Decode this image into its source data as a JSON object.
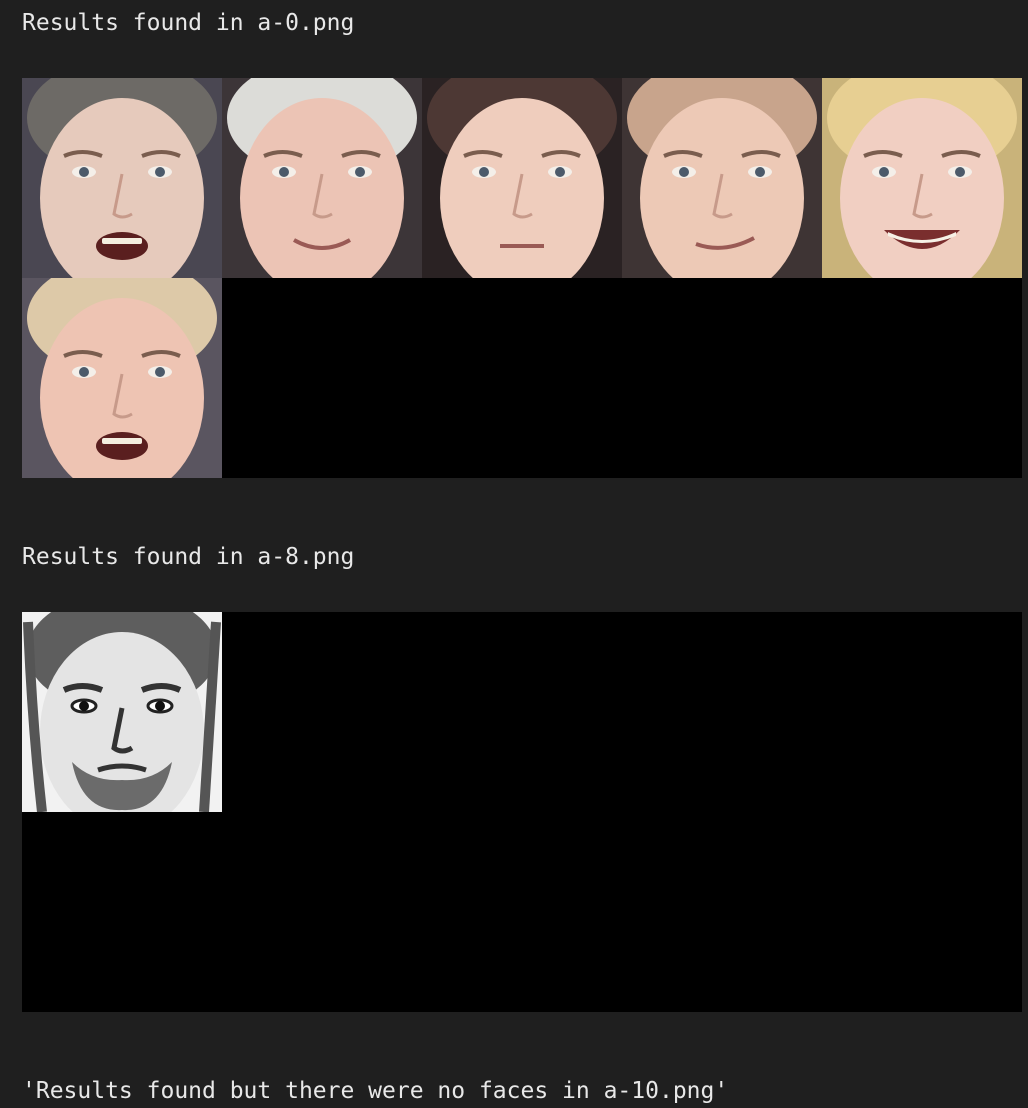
{
  "outputs": [
    {
      "kind": "grid",
      "heading": "Results found in a-0.png",
      "faces": [
        {
          "label": "face-1",
          "icon": "face-thumbnail-icon",
          "skin": "#e6cabc",
          "hair": "#6d6a66",
          "bg": "#4a4752",
          "mouth": "open"
        },
        {
          "label": "face-2",
          "icon": "face-thumbnail-icon",
          "skin": "#ecc4b5",
          "hair": "#dcdcd8",
          "bg": "#3c3538",
          "mouth": "smile"
        },
        {
          "label": "face-3",
          "icon": "face-thumbnail-icon",
          "skin": "#efcdbd",
          "hair": "#4d3834",
          "bg": "#2a2223",
          "mouth": "neutral"
        },
        {
          "label": "face-4",
          "icon": "face-thumbnail-icon",
          "skin": "#edc9b6",
          "hair": "#c8a48c",
          "bg": "#3e3434",
          "mouth": "smirk"
        },
        {
          "label": "face-5",
          "icon": "face-thumbnail-icon",
          "skin": "#f1cfc2",
          "hair": "#e7cf92",
          "bg": "#c9b37a",
          "mouth": "grin"
        },
        {
          "label": "face-6",
          "icon": "face-thumbnail-icon",
          "skin": "#eec4b3",
          "hair": "#ddc9a8",
          "bg": "#5a5560",
          "mouth": "open"
        }
      ]
    },
    {
      "kind": "grid",
      "heading": "Results found in a-8.png",
      "faces": [
        {
          "label": "face-sketch",
          "icon": "sketch-face-thumbnail-icon",
          "skin": "#e4e4e4",
          "hair": "#5e5e5e",
          "bg": "#f2f2f2",
          "mouth": "beard"
        }
      ]
    },
    {
      "kind": "text",
      "heading": "'Results found but there were no faces in a-10.png'"
    }
  ]
}
